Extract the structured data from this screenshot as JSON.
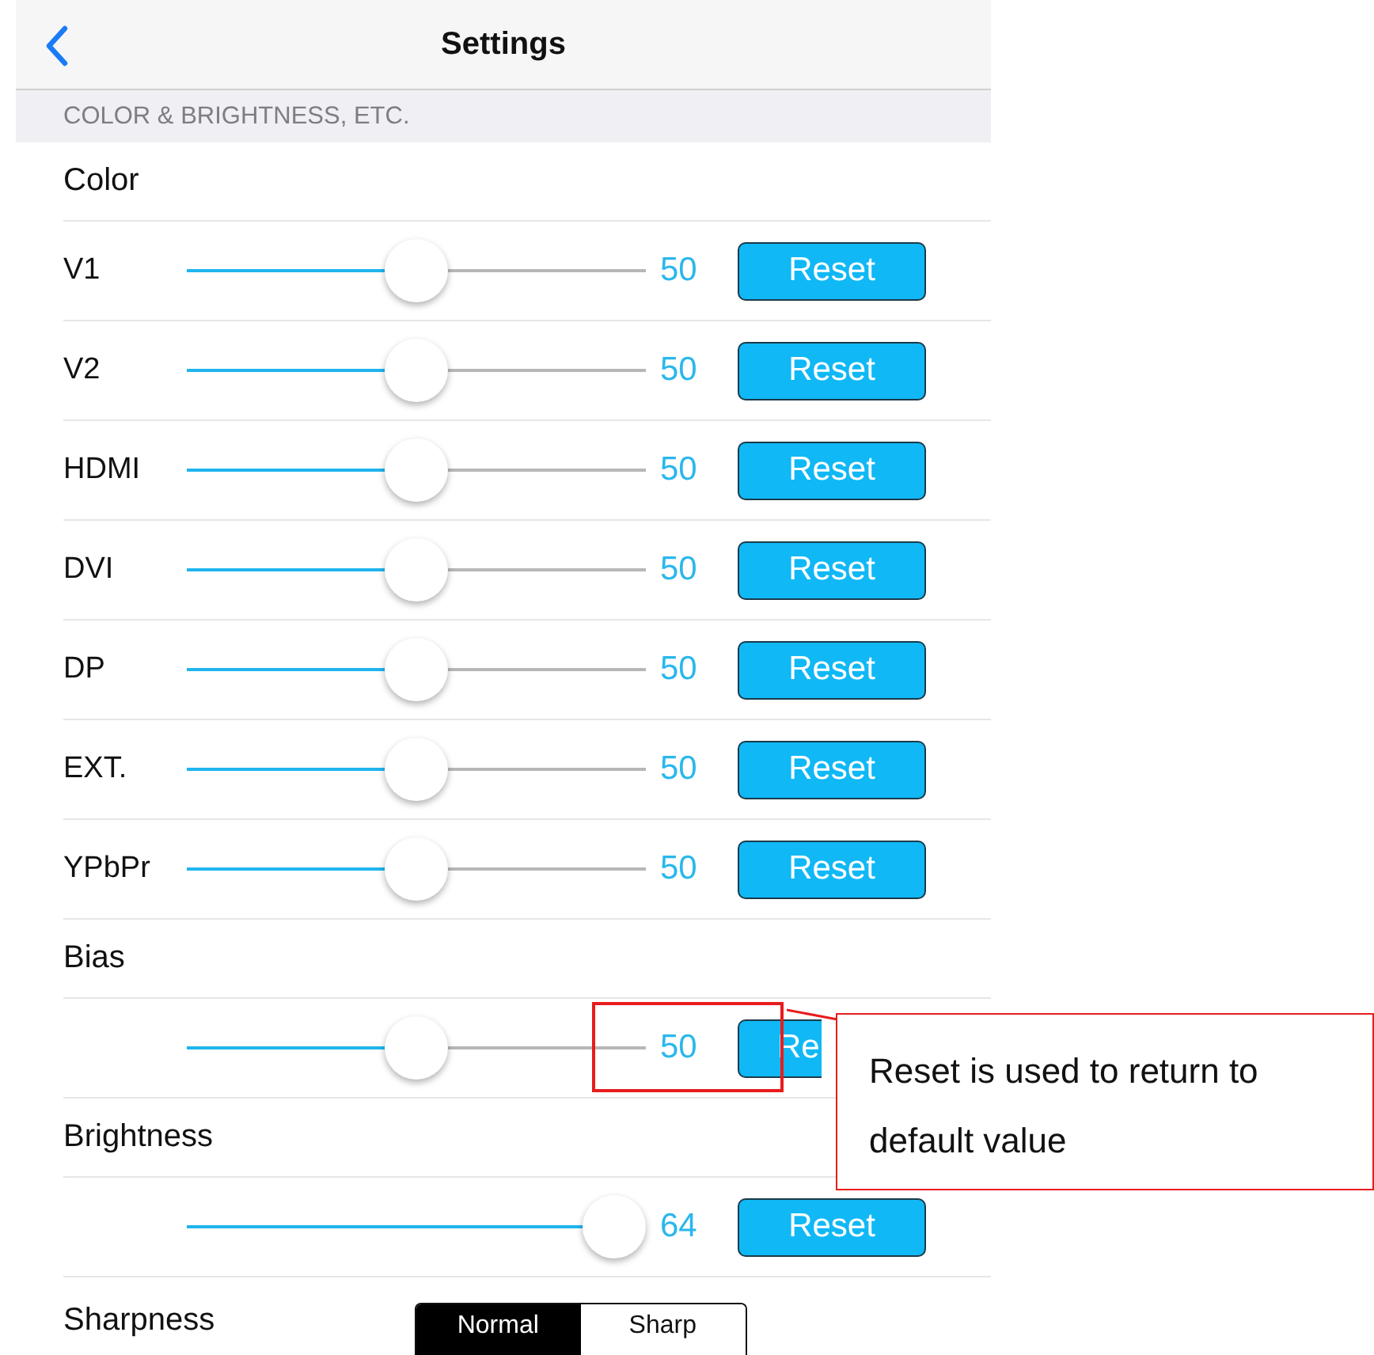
{
  "nav": {
    "title": "Settings"
  },
  "section_header": "COLOR & BRIGHTNESS, ETC.",
  "rows": [
    {
      "kind": "group",
      "label": "Color"
    },
    {
      "kind": "slider",
      "label": "V1",
      "level": 0.5,
      "reading": "50",
      "button": "Reset"
    },
    {
      "kind": "slider",
      "label": "V2",
      "level": 0.5,
      "reading": "50",
      "button": "Reset"
    },
    {
      "kind": "slider",
      "label": "HDMI",
      "level": 0.5,
      "reading": "50",
      "button": "Reset"
    },
    {
      "kind": "slider",
      "label": "DVI",
      "level": 0.5,
      "reading": "50",
      "button": "Reset"
    },
    {
      "kind": "slider",
      "label": "DP",
      "level": 0.5,
      "reading": "50",
      "button": "Reset"
    },
    {
      "kind": "slider",
      "label": "EXT.",
      "level": 0.5,
      "reading": "50",
      "button": "Reset"
    },
    {
      "kind": "slider",
      "label": "YPbPr",
      "level": 0.5,
      "reading": "50",
      "button": "Reset"
    },
    {
      "kind": "group",
      "label": "Bias"
    },
    {
      "kind": "slider",
      "level": 0.5,
      "reading": "50",
      "button": "Re",
      "highlighted": true
    },
    {
      "kind": "group",
      "label": "Brightness"
    },
    {
      "kind": "slider",
      "level": 0.93,
      "reading": "64",
      "button": "Reset"
    },
    {
      "kind": "segmented",
      "label": "Sharpness",
      "options": [
        {
          "label": "Normal",
          "selected": true
        },
        {
          "label": "Sharp",
          "selected": false
        }
      ]
    }
  ],
  "callout": {
    "text": "Reset is used to return to default value"
  }
}
